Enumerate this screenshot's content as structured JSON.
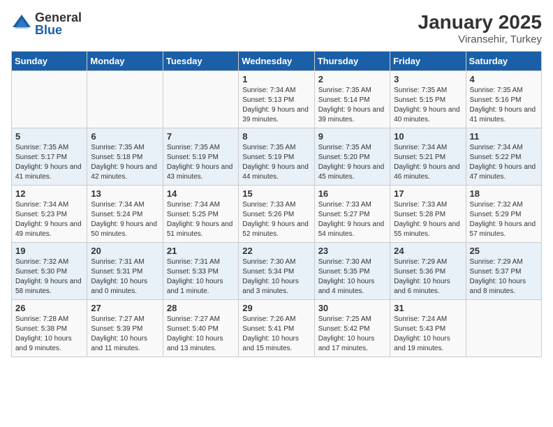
{
  "logo": {
    "general": "General",
    "blue": "Blue"
  },
  "title": "January 2025",
  "subtitle": "Viransehir, Turkey",
  "headers": [
    "Sunday",
    "Monday",
    "Tuesday",
    "Wednesday",
    "Thursday",
    "Friday",
    "Saturday"
  ],
  "weeks": [
    [
      {
        "day": "",
        "sunrise": "",
        "sunset": "",
        "daylight": ""
      },
      {
        "day": "",
        "sunrise": "",
        "sunset": "",
        "daylight": ""
      },
      {
        "day": "",
        "sunrise": "",
        "sunset": "",
        "daylight": ""
      },
      {
        "day": "1",
        "sunrise": "Sunrise: 7:34 AM",
        "sunset": "Sunset: 5:13 PM",
        "daylight": "Daylight: 9 hours and 39 minutes."
      },
      {
        "day": "2",
        "sunrise": "Sunrise: 7:35 AM",
        "sunset": "Sunset: 5:14 PM",
        "daylight": "Daylight: 9 hours and 39 minutes."
      },
      {
        "day": "3",
        "sunrise": "Sunrise: 7:35 AM",
        "sunset": "Sunset: 5:15 PM",
        "daylight": "Daylight: 9 hours and 40 minutes."
      },
      {
        "day": "4",
        "sunrise": "Sunrise: 7:35 AM",
        "sunset": "Sunset: 5:16 PM",
        "daylight": "Daylight: 9 hours and 41 minutes."
      }
    ],
    [
      {
        "day": "5",
        "sunrise": "Sunrise: 7:35 AM",
        "sunset": "Sunset: 5:17 PM",
        "daylight": "Daylight: 9 hours and 41 minutes."
      },
      {
        "day": "6",
        "sunrise": "Sunrise: 7:35 AM",
        "sunset": "Sunset: 5:18 PM",
        "daylight": "Daylight: 9 hours and 42 minutes."
      },
      {
        "day": "7",
        "sunrise": "Sunrise: 7:35 AM",
        "sunset": "Sunset: 5:19 PM",
        "daylight": "Daylight: 9 hours and 43 minutes."
      },
      {
        "day": "8",
        "sunrise": "Sunrise: 7:35 AM",
        "sunset": "Sunset: 5:19 PM",
        "daylight": "Daylight: 9 hours and 44 minutes."
      },
      {
        "day": "9",
        "sunrise": "Sunrise: 7:35 AM",
        "sunset": "Sunset: 5:20 PM",
        "daylight": "Daylight: 9 hours and 45 minutes."
      },
      {
        "day": "10",
        "sunrise": "Sunrise: 7:34 AM",
        "sunset": "Sunset: 5:21 PM",
        "daylight": "Daylight: 9 hours and 46 minutes."
      },
      {
        "day": "11",
        "sunrise": "Sunrise: 7:34 AM",
        "sunset": "Sunset: 5:22 PM",
        "daylight": "Daylight: 9 hours and 47 minutes."
      }
    ],
    [
      {
        "day": "12",
        "sunrise": "Sunrise: 7:34 AM",
        "sunset": "Sunset: 5:23 PM",
        "daylight": "Daylight: 9 hours and 49 minutes."
      },
      {
        "day": "13",
        "sunrise": "Sunrise: 7:34 AM",
        "sunset": "Sunset: 5:24 PM",
        "daylight": "Daylight: 9 hours and 50 minutes."
      },
      {
        "day": "14",
        "sunrise": "Sunrise: 7:34 AM",
        "sunset": "Sunset: 5:25 PM",
        "daylight": "Daylight: 9 hours and 51 minutes."
      },
      {
        "day": "15",
        "sunrise": "Sunrise: 7:33 AM",
        "sunset": "Sunset: 5:26 PM",
        "daylight": "Daylight: 9 hours and 52 minutes."
      },
      {
        "day": "16",
        "sunrise": "Sunrise: 7:33 AM",
        "sunset": "Sunset: 5:27 PM",
        "daylight": "Daylight: 9 hours and 54 minutes."
      },
      {
        "day": "17",
        "sunrise": "Sunrise: 7:33 AM",
        "sunset": "Sunset: 5:28 PM",
        "daylight": "Daylight: 9 hours and 55 minutes."
      },
      {
        "day": "18",
        "sunrise": "Sunrise: 7:32 AM",
        "sunset": "Sunset: 5:29 PM",
        "daylight": "Daylight: 9 hours and 57 minutes."
      }
    ],
    [
      {
        "day": "19",
        "sunrise": "Sunrise: 7:32 AM",
        "sunset": "Sunset: 5:30 PM",
        "daylight": "Daylight: 9 hours and 58 minutes."
      },
      {
        "day": "20",
        "sunrise": "Sunrise: 7:31 AM",
        "sunset": "Sunset: 5:31 PM",
        "daylight": "Daylight: 10 hours and 0 minutes."
      },
      {
        "day": "21",
        "sunrise": "Sunrise: 7:31 AM",
        "sunset": "Sunset: 5:33 PM",
        "daylight": "Daylight: 10 hours and 1 minute."
      },
      {
        "day": "22",
        "sunrise": "Sunrise: 7:30 AM",
        "sunset": "Sunset: 5:34 PM",
        "daylight": "Daylight: 10 hours and 3 minutes."
      },
      {
        "day": "23",
        "sunrise": "Sunrise: 7:30 AM",
        "sunset": "Sunset: 5:35 PM",
        "daylight": "Daylight: 10 hours and 4 minutes."
      },
      {
        "day": "24",
        "sunrise": "Sunrise: 7:29 AM",
        "sunset": "Sunset: 5:36 PM",
        "daylight": "Daylight: 10 hours and 6 minutes."
      },
      {
        "day": "25",
        "sunrise": "Sunrise: 7:29 AM",
        "sunset": "Sunset: 5:37 PM",
        "daylight": "Daylight: 10 hours and 8 minutes."
      }
    ],
    [
      {
        "day": "26",
        "sunrise": "Sunrise: 7:28 AM",
        "sunset": "Sunset: 5:38 PM",
        "daylight": "Daylight: 10 hours and 9 minutes."
      },
      {
        "day": "27",
        "sunrise": "Sunrise: 7:27 AM",
        "sunset": "Sunset: 5:39 PM",
        "daylight": "Daylight: 10 hours and 11 minutes."
      },
      {
        "day": "28",
        "sunrise": "Sunrise: 7:27 AM",
        "sunset": "Sunset: 5:40 PM",
        "daylight": "Daylight: 10 hours and 13 minutes."
      },
      {
        "day": "29",
        "sunrise": "Sunrise: 7:26 AM",
        "sunset": "Sunset: 5:41 PM",
        "daylight": "Daylight: 10 hours and 15 minutes."
      },
      {
        "day": "30",
        "sunrise": "Sunrise: 7:25 AM",
        "sunset": "Sunset: 5:42 PM",
        "daylight": "Daylight: 10 hours and 17 minutes."
      },
      {
        "day": "31",
        "sunrise": "Sunrise: 7:24 AM",
        "sunset": "Sunset: 5:43 PM",
        "daylight": "Daylight: 10 hours and 19 minutes."
      },
      {
        "day": "",
        "sunrise": "",
        "sunset": "",
        "daylight": ""
      }
    ]
  ]
}
